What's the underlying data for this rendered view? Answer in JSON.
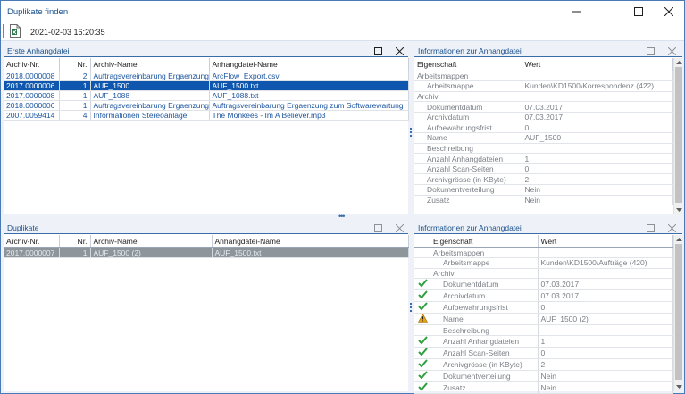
{
  "window": {
    "title": "Duplikate finden"
  },
  "toolbar": {
    "timestamp": "2021-02-03 16:20:35",
    "icon": "excel-file-icon"
  },
  "first_pane": {
    "title": "Erste Anhangdatei",
    "columns": [
      "Archiv-Nr.",
      "Nr.",
      "Archiv-Name",
      "Anhangdatei-Name"
    ],
    "rows": [
      [
        "2018.0000008",
        "2",
        "Auftragsvereinbarung Ergaenzung",
        "ArcFlow_Export.csv"
      ],
      [
        "2017.0000006",
        "1",
        "AUF_1500",
        "AUF_1500.txt"
      ],
      [
        "2017.0000008",
        "1",
        "AUF_1088",
        "AUF_1088.txt"
      ],
      [
        "2018.0000006",
        "1",
        "Auftragsvereinbarung Ergaenzung",
        "Auftragsvereinbarung Ergaenzung zum Softwarewartung"
      ],
      [
        "2007.0059414",
        "4",
        "Informationen Stereoanlage",
        "The Monkees - Im A Believer.mp3"
      ]
    ],
    "selected_row": 1
  },
  "dup_pane": {
    "title": "Duplikate",
    "columns": [
      "Archiv-Nr.",
      "Nr.",
      "Archiv-Name",
      "Anhangdatei-Name"
    ],
    "rows": [
      [
        "2017.0000007",
        "1",
        "AUF_1500 (2)",
        "AUF_1500.txt"
      ]
    ]
  },
  "info_top": {
    "title": "Informationen zur Anhangdatei",
    "col_property": "Eigenschaft",
    "col_value": "Wert",
    "rows": [
      {
        "prop": "Arbeitsmappen",
        "value": "",
        "indent": 0
      },
      {
        "prop": "Arbeitsmappe",
        "value": "Kunden\\KD1500\\Korrespondenz (422)",
        "indent": 1
      },
      {
        "prop": "Archiv",
        "value": "",
        "indent": 0
      },
      {
        "prop": "Dokumentdatum",
        "value": "07.03.2017",
        "indent": 1
      },
      {
        "prop": "Archivdatum",
        "value": "07.03.2017",
        "indent": 1
      },
      {
        "prop": "Aufbewahrungsfrist",
        "value": "0",
        "indent": 1
      },
      {
        "prop": "Name",
        "value": "AUF_1500",
        "indent": 1
      },
      {
        "prop": "Beschreibung",
        "value": "",
        "indent": 1
      },
      {
        "prop": "Anzahl Anhangdateien",
        "value": "1",
        "indent": 1
      },
      {
        "prop": "Anzahl Scan-Seiten",
        "value": "0",
        "indent": 1
      },
      {
        "prop": "Archivgrösse (in KByte)",
        "value": "2",
        "indent": 1
      },
      {
        "prop": "Dokumentverteilung",
        "value": "Nein",
        "indent": 1
      },
      {
        "prop": "Zusatz",
        "value": "Nein",
        "indent": 1
      }
    ]
  },
  "info_bottom": {
    "title": "Informationen zur Anhangdatei",
    "col_property": "Eigenschaft",
    "col_value": "Wert",
    "rows": [
      {
        "prop": "Arbeitsmappen",
        "value": "",
        "indent": 0,
        "status": ""
      },
      {
        "prop": "Arbeitsmappe",
        "value": "Kunden\\KD1500\\Aufträge (420)",
        "indent": 1,
        "status": ""
      },
      {
        "prop": "Archiv",
        "value": "",
        "indent": 0,
        "status": ""
      },
      {
        "prop": "Dokumentdatum",
        "value": "07.03.2017",
        "indent": 1,
        "status": "check"
      },
      {
        "prop": "Archivdatum",
        "value": "07.03.2017",
        "indent": 1,
        "status": "check"
      },
      {
        "prop": "Aufbewahrungsfrist",
        "value": "0",
        "indent": 1,
        "status": "check"
      },
      {
        "prop": "Name",
        "value": "AUF_1500 (2)",
        "indent": 1,
        "status": "warning"
      },
      {
        "prop": "Beschreibung",
        "value": "",
        "indent": 1,
        "status": ""
      },
      {
        "prop": "Anzahl Anhangdateien",
        "value": "1",
        "indent": 1,
        "status": "check"
      },
      {
        "prop": "Anzahl Scan-Seiten",
        "value": "0",
        "indent": 1,
        "status": "check"
      },
      {
        "prop": "Archivgrösse (in KByte)",
        "value": "2",
        "indent": 1,
        "status": "check"
      },
      {
        "prop": "Dokumentverteilung",
        "value": "Nein",
        "indent": 1,
        "status": "check"
      },
      {
        "prop": "Zusatz",
        "value": "Nein",
        "indent": 1,
        "status": "check"
      }
    ]
  },
  "colors": {
    "accent": "#0f57ae",
    "header_text": "#1a4f8a",
    "check": "#2e9e3e",
    "warning": "#e8a317"
  }
}
